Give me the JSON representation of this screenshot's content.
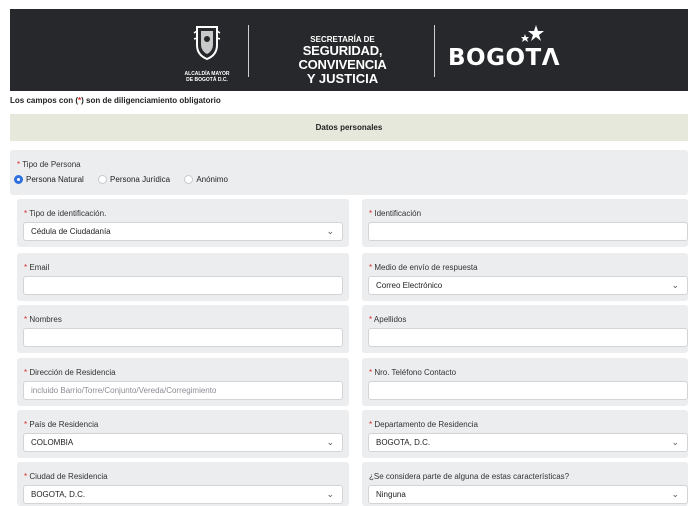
{
  "header": {
    "escudo_line1": "ALCALDÍA MAYOR",
    "escudo_line2": "DE BOGOTÁ D.C.",
    "secretaria_line1": "SECRETARÍA DE",
    "secretaria_line2": "SEGURIDAD, CONVIVENCIA",
    "secretaria_line3": "Y JUSTICIA",
    "bogota_logo": "BOGOTΛ"
  },
  "required_note": {
    "prefix": "Los campos con (",
    "star": "*",
    "suffix": ") son de diligenciamiento obligatorio"
  },
  "section_title": "Datos personales",
  "tipo_persona": {
    "label": "Tipo de Persona",
    "options": [
      "Persona Natural",
      "Persona Jurídica",
      "Anónimo"
    ],
    "selected": "Persona Natural"
  },
  "fields": {
    "tipo_id": {
      "label": "Tipo de identificación.",
      "value": "Cédula de Ciudadanía"
    },
    "identificacion": {
      "label": "Identificación",
      "value": ""
    },
    "email": {
      "label": "Email",
      "value": ""
    },
    "medio_envio": {
      "label": "Medio de envío de respuesta",
      "value": "Correo Electrónico"
    },
    "nombres": {
      "label": "Nombres",
      "value": ""
    },
    "apellidos": {
      "label": "Apellidos",
      "value": ""
    },
    "direccion": {
      "label": "Dirección de Residencia",
      "placeholder": "incluido Barrio/Torre/Conjunto/Vereda/Corregimiento"
    },
    "telefono": {
      "label": "Nro. Teléfono Contacto",
      "value": ""
    },
    "pais": {
      "label": "País de Residencia",
      "value": "COLOMBIA"
    },
    "departamento": {
      "label": "Departamento de Residencia",
      "value": "BOGOTA, D.C."
    },
    "ciudad": {
      "label": "Ciudad de Residencia",
      "value": "BOGOTA, D.C."
    },
    "caracteristicas": {
      "label": "¿Se considera parte de alguna de estas características?",
      "value": "Ninguna"
    }
  },
  "required_marker": "*",
  "caret_glyph": "⌄",
  "colors": {
    "header_bg": "#27282b",
    "section_bar": "#e6e8dc",
    "card_bg": "#ecedef",
    "required": "#d9262b",
    "radio_selected": "#2f6fe0"
  }
}
